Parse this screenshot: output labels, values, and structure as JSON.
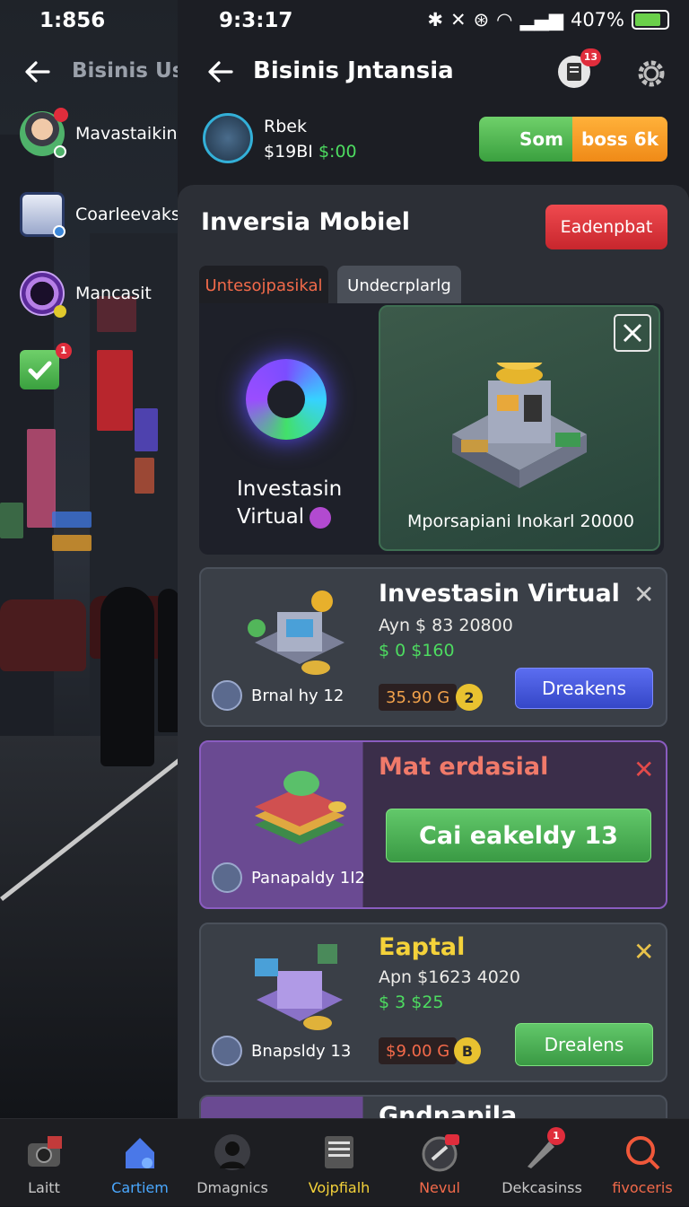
{
  "left_panel": {
    "status_time": "1:856",
    "title": "Bisinis Usn",
    "items": [
      {
        "label": "Mavastaikin"
      },
      {
        "label": "Coarleevakso"
      },
      {
        "label": "Mancasit"
      }
    ],
    "check_badge": "1"
  },
  "status_bar": {
    "time": "9:3:17",
    "battery": "407%"
  },
  "header": {
    "title": "Bisinis Jntansia",
    "notif_badge": "13"
  },
  "profile": {
    "name": "Rbek",
    "balance_prefix": "$19BI",
    "balance_value": "$:00"
  },
  "boss_button": {
    "left": "Som",
    "right": "boss 6k"
  },
  "sheet": {
    "title": "Inversia Mobiel",
    "action_button": "Eadenpbat",
    "tabs": [
      "Untesojpasikal",
      "Undecrplarlg"
    ]
  },
  "hero": {
    "left_line1": "Investasin",
    "left_line2": "Virtual",
    "card_caption": "Mporsapiani Inokarl 20000"
  },
  "cards": [
    {
      "title": "Investasin Virtual",
      "sub": "Ayn $ 83 20800",
      "green": "$ 0 $160",
      "tag": "Brnal hy 12",
      "price": "35.90 G",
      "coin": "2",
      "button": "Dreakens"
    },
    {
      "title": "Mat erdasial",
      "tag": "Panapaldy 1I2",
      "button": "Cai eakeldy 13"
    },
    {
      "title": "Eaptal",
      "sub": "Apn $1623 4020",
      "green": "$ 3 $25",
      "tag": "Bnapsldy 13",
      "price": "$9.00 G",
      "coin": "B",
      "button": "Drealens"
    },
    {
      "title": "Gndnapila"
    }
  ],
  "nav": [
    {
      "label": "Laitt"
    },
    {
      "label": "Cartiem"
    },
    {
      "label": "Dmagnics"
    },
    {
      "label": "Vojpfialh"
    },
    {
      "label": "Nevul"
    },
    {
      "label": "Dekcasinss"
    },
    {
      "label": "fivoceris"
    }
  ],
  "nav_badges": {
    "vojp": "",
    "nevul": "",
    "dekc": "1"
  },
  "colors": {
    "accent_green": "#4ddb60",
    "accent_red": "#e02d3c",
    "accent_orange": "#f08a17",
    "accent_blue": "#3547c8"
  }
}
